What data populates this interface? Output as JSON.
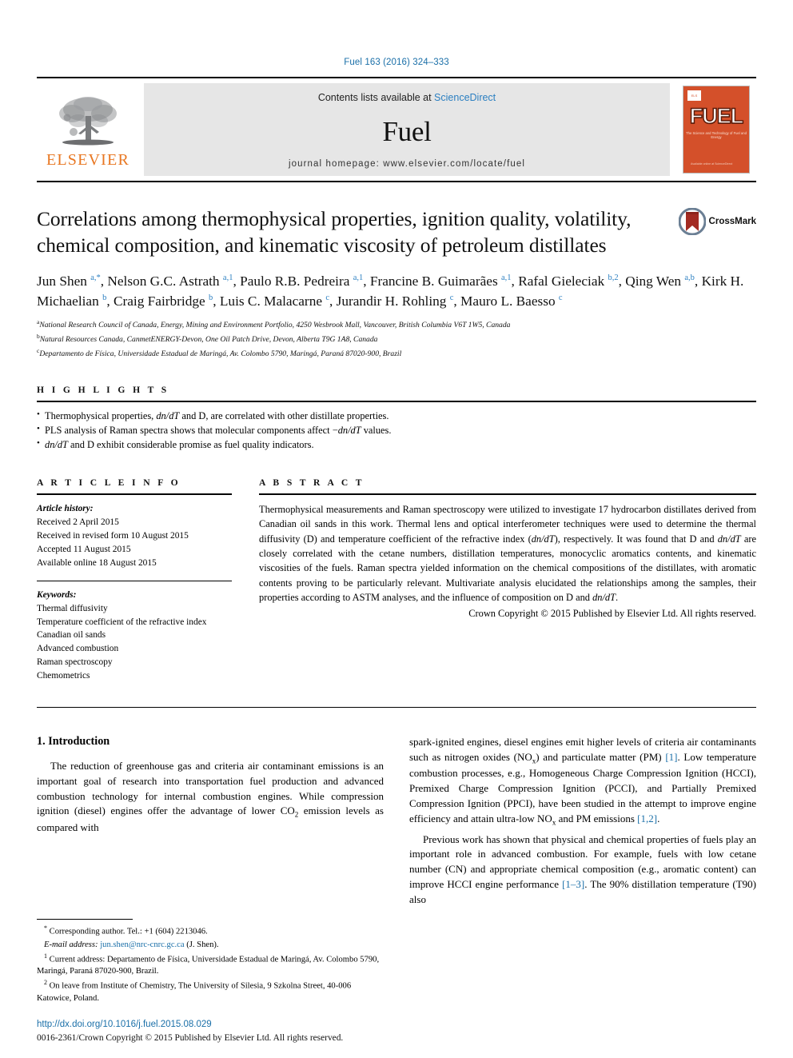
{
  "running_head": "Fuel 163 (2016) 324–333",
  "masthead": {
    "publisher_name": "ELSEVIER",
    "contents_prefix": "Contents lists available at ",
    "sciencedirect": "ScienceDirect",
    "journal_name": "Fuel",
    "homepage": "journal homepage: www.elsevier.com/locate/fuel",
    "cover": {
      "title": "FUEL",
      "subtitle": "The Science and Technology of Fuel and Energy",
      "footer": "Available online at\nScienceDirect"
    }
  },
  "article": {
    "title": "Correlations among thermophysical properties, ignition quality, volatility, chemical composition, and kinematic viscosity of petroleum distillates",
    "crossmark_label": "CrossMark",
    "authors_html": "Jun Shen <sup>a,*</sup>, Nelson G.C. Astrath <sup>a,1</sup>, Paulo R.B. Pedreira <sup>a,1</sup>, Francine B. Guimarães <sup>a,1</sup>, Rafal Gieleciak <sup>b,2</sup>, Qing Wen <sup>a,b</sup>, Kirk H. Michaelian <sup>b</sup>, Craig Fairbridge <sup>b</sup>, Luis C. Malacarne <sup>c</sup>, Jurandir H. Rohling <sup>c</sup>, Mauro L. Baesso <sup>c</sup>",
    "affiliations": [
      {
        "marker": "a",
        "text": "National Research Council of Canada, Energy, Mining and Environment Portfolio, 4250 Wesbrook Mall, Vancouver, British Columbia V6T 1W5, Canada"
      },
      {
        "marker": "b",
        "text": "Natural Resources Canada, CanmetENERGY-Devon, One Oil Patch Drive, Devon, Alberta T9G 1A8, Canada"
      },
      {
        "marker": "c",
        "text": "Departamento de Física, Universidade Estadual de Maringá, Av. Colombo 5790, Maringá, Paraná 87020-900, Brazil"
      }
    ]
  },
  "highlights": {
    "heading": "H I G H L I G H T S",
    "items_html": [
      "Thermophysical properties, <i>dn/dT</i> and D, are correlated with other distillate properties.",
      "PLS analysis of Raman spectra shows that molecular components affect &minus;<i>dn/dT</i> values.",
      "<i>dn/dT</i> and D exhibit considerable promise as fuel quality indicators."
    ]
  },
  "article_info": {
    "heading": "A R T I C L E   I N F O",
    "history_label": "Article history:",
    "history": [
      "Received 2 April 2015",
      "Received in revised form 10 August 2015",
      "Accepted 11 August 2015",
      "Available online 18 August 2015"
    ],
    "keywords_label": "Keywords:",
    "keywords": [
      "Thermal diffusivity",
      "Temperature coefficient of the refractive index",
      "Canadian oil sands",
      "Advanced combustion",
      "Raman spectroscopy",
      "Chemometrics"
    ]
  },
  "abstract": {
    "heading": "A B S T R A C T",
    "text_html": "Thermophysical measurements and Raman spectroscopy were utilized to investigate 17 hydrocarbon distillates derived from Canadian oil sands in this work. Thermal lens and optical interferometer techniques were used to determine the thermal diffusivity (D) and temperature coefficient of the refractive index (<i>dn/dT</i>), respectively. It was found that D and <i>dn/dT</i> are closely correlated with the cetane numbers, distillation temperatures, monocyclic aromatics contents, and kinematic viscosities of the fuels. Raman spectra yielded information on the chemical compositions of the distillates, with aromatic contents proving to be particularly relevant. Multivariate analysis elucidated the relationships among the samples, their properties according to ASTM analyses, and the influence of composition on D and <i>dn/dT</i>.",
    "copyright": "Crown Copyright © 2015 Published by Elsevier Ltd. All rights reserved."
  },
  "introduction": {
    "section_title": "1. Introduction",
    "left_paragraphs_html": [
      "The reduction of greenhouse gas and criteria air contaminant emissions is an important goal of research into transportation fuel production and advanced combustion technology for internal combustion engines. While compression ignition (diesel) engines offer the advantage of lower CO<sub>2</sub> emission levels as compared with"
    ],
    "right_paragraphs_html": [
      "spark-ignited engines, diesel engines emit higher levels of criteria air contaminants such as nitrogen oxides (NO<sub>x</sub>) and particulate matter (PM) <span class=\"cite\">[1]</span>. Low temperature combustion processes, e.g., Homogeneous Charge Compression Ignition (HCCI), Premixed Charge Compression Ignition (PCCI), and Partially Premixed Compression Ignition (PPCI), have been studied in the attempt to improve engine efficiency and attain ultra-low NO<sub>x</sub> and PM emissions <span class=\"cite\">[1,2]</span>.",
      "Previous work has shown that physical and chemical properties of fuels play an important role in advanced combustion. For example, fuels with low cetane number (CN) and appropriate chemical composition (e.g., aromatic content) can improve HCCI engine performance <span class=\"cite\">[1–3]</span>. The 90% distillation temperature (T90) also"
    ]
  },
  "footnotes": {
    "items_html": [
      "<sup>*</sup> Corresponding author. Tel.: +1 (604) 2213046.",
      "<i>E-mail address:</i> <span class=\"link\">jun.shen@nrc-cnrc.gc.ca</span> (J. Shen).",
      "<sup>1</sup> Current address: Departamento de Física, Universidade Estadual de Maringá, Av. Colombo 5790, Maringá, Paraná 87020-900, Brazil.",
      "<sup>2</sup> On leave from Institute of Chemistry, The University of Silesia, 9 Szkolna Street, 40-006 Katowice, Poland."
    ],
    "doi": "http://dx.doi.org/10.1016/j.fuel.2015.08.029",
    "issn_copyright": "0016-2361/Crown Copyright © 2015 Published by Elsevier Ltd. All rights reserved."
  },
  "colors": {
    "link_blue": "#1a6fa8",
    "sciencedirect_blue": "#2b7fc1",
    "elsevier_orange": "#E87722",
    "cover_red": "#d4502a"
  }
}
